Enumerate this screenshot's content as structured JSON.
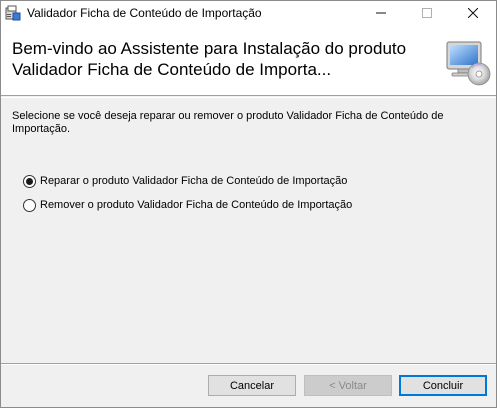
{
  "window": {
    "title": "Validador Ficha de Conteúdo de Importação",
    "controls": {
      "minimize": "minimize",
      "maximize": "maximize",
      "close": "close"
    }
  },
  "header": {
    "title": "Bem-vindo ao Assistente para Instalação do produto Validador Ficha de Conteúdo de Importa..."
  },
  "body": {
    "description": "Selecione se você deseja reparar ou remover o produto Validador Ficha de Conteúdo de Importação.",
    "options": [
      {
        "label": "Reparar o produto Validador Ficha de Conteúdo de Importação",
        "selected": true
      },
      {
        "label": "Remover o produto Validador Ficha de Conteúdo de Importação",
        "selected": false
      }
    ]
  },
  "footer": {
    "cancel_label": "Cancelar",
    "back_label": "< Voltar",
    "finish_label": "Concluir",
    "back_enabled": false
  },
  "colors": {
    "default_button_border": "#0078d7",
    "dialog_background": "#f0f0f0",
    "header_background": "#ffffff"
  },
  "icons": {
    "title": "installer-icon",
    "header": "computer-cd-icon"
  }
}
